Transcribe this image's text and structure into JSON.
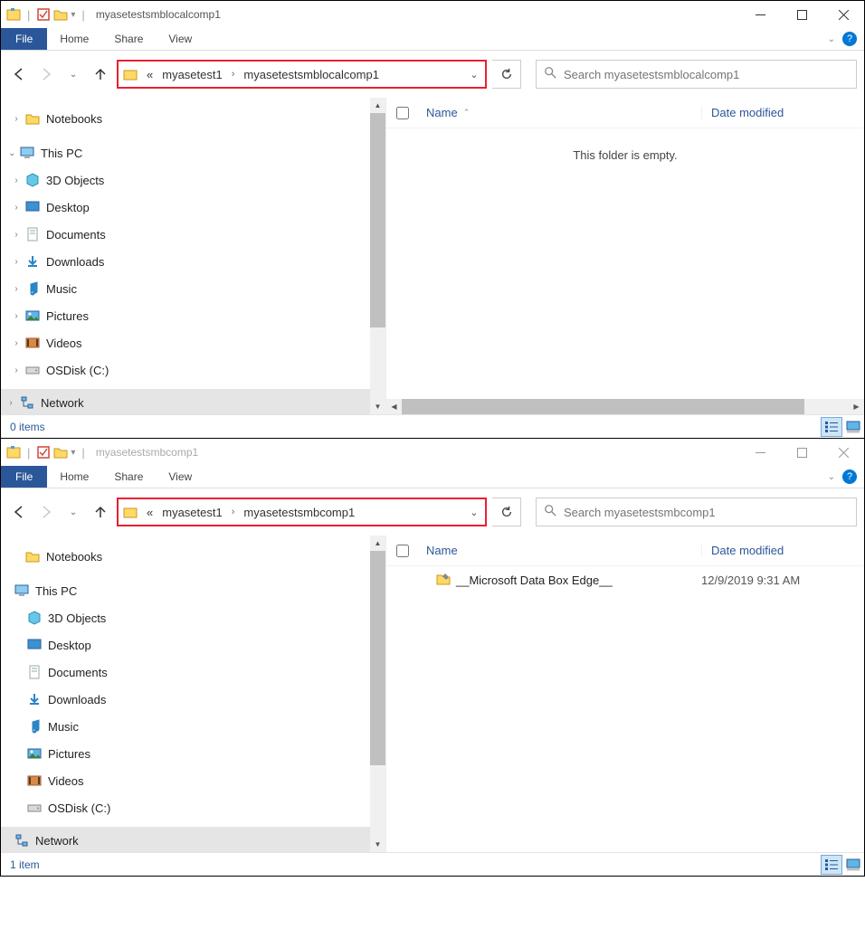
{
  "windows": [
    {
      "title": "myasetestsmblocalcomp1",
      "active": true,
      "menu": {
        "file": "File",
        "home": "Home",
        "share": "Share",
        "view": "View"
      },
      "breadcrumb": {
        "prefix": "«",
        "seg1": "myasetest1",
        "seg2": "myasetestsmblocalcomp1"
      },
      "search_placeholder": "Search myasetestsmblocalcomp1",
      "columns": {
        "name": "Name",
        "date": "Date modified"
      },
      "empty_message": "This folder is empty.",
      "tree": {
        "notebooks": "Notebooks",
        "thispc": "This PC",
        "objects3d": "3D Objects",
        "desktop": "Desktop",
        "documents": "Documents",
        "downloads": "Downloads",
        "music": "Music",
        "pictures": "Pictures",
        "videos": "Videos",
        "osdisk": "OSDisk (C:)",
        "network": "Network"
      },
      "status": "0 items"
    },
    {
      "title": "myasetestsmbcomp1",
      "active": false,
      "menu": {
        "file": "File",
        "home": "Home",
        "share": "Share",
        "view": "View"
      },
      "breadcrumb": {
        "prefix": "«",
        "seg1": "myasetest1",
        "seg2": "myasetestsmbcomp1"
      },
      "search_placeholder": "Search myasetestsmbcomp1",
      "columns": {
        "name": "Name",
        "date": "Date modified"
      },
      "files": [
        {
          "name": "__Microsoft Data Box Edge__",
          "date": "12/9/2019 9:31 AM"
        }
      ],
      "tree": {
        "notebooks": "Notebooks",
        "thispc": "This PC",
        "objects3d": "3D Objects",
        "desktop": "Desktop",
        "documents": "Documents",
        "downloads": "Downloads",
        "music": "Music",
        "pictures": "Pictures",
        "videos": "Videos",
        "osdisk": "OSDisk (C:)",
        "network": "Network"
      },
      "status": "1 item"
    }
  ]
}
